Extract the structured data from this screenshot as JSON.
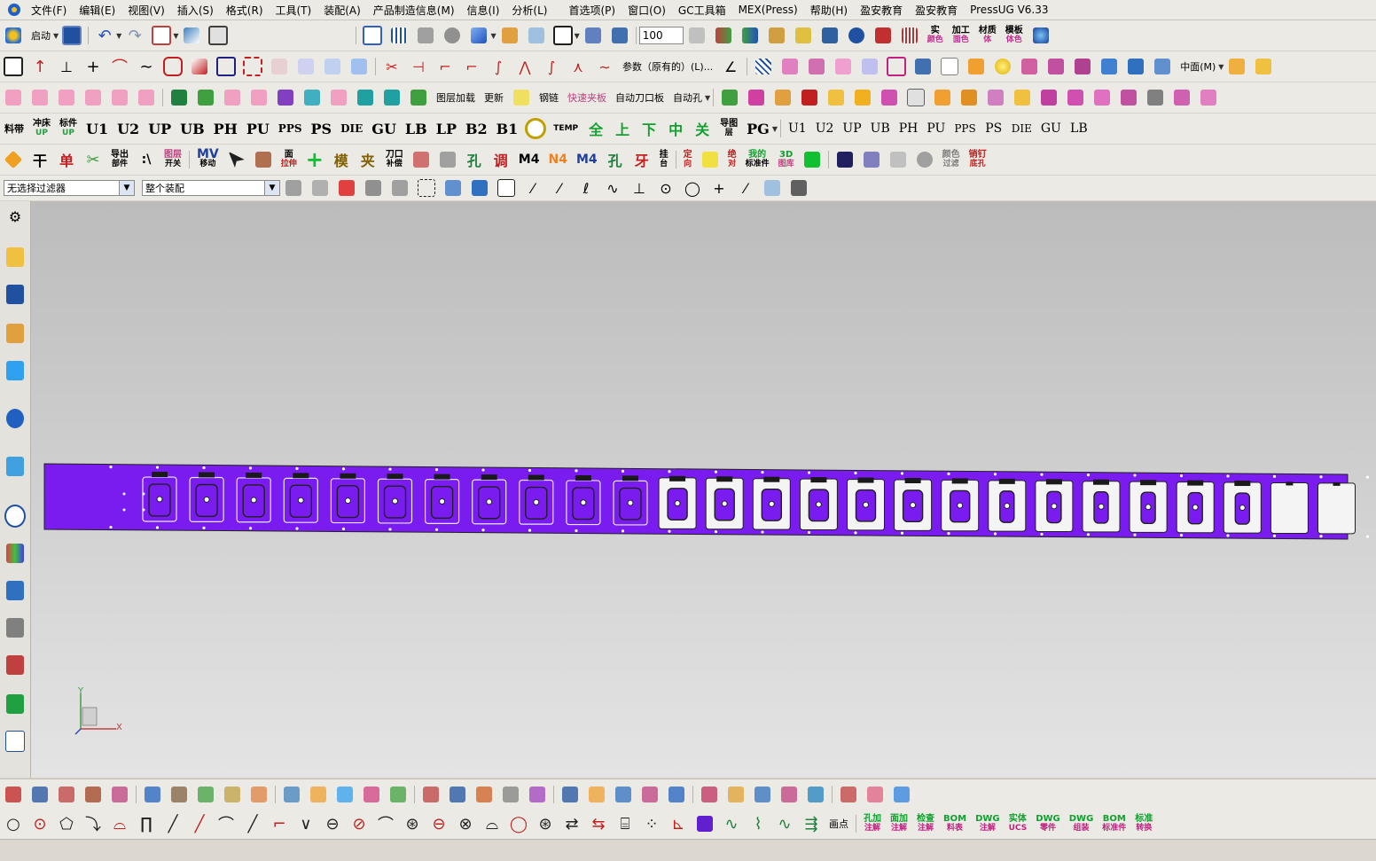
{
  "menu": [
    "文件(F)",
    "编辑(E)",
    "视图(V)",
    "插入(S)",
    "格式(R)",
    "工具(T)",
    "装配(A)",
    "产品制造信息(M)",
    "信息(I)",
    "分析(L)",
    "首选项(P)",
    "窗口(O)",
    "GC工具箱",
    "MEX(Press)",
    "帮助(H)",
    "盈安教育",
    "盈安教育",
    "PressUG V6.33"
  ],
  "toolbar1": {
    "start_label": "启动",
    "zoom_value": "100",
    "right_labels": [
      [
        "实",
        "颜色"
      ],
      [
        "加工",
        "面色"
      ],
      [
        "材质",
        "体"
      ],
      [
        "模板",
        "体色"
      ]
    ]
  },
  "toolbar2": {
    "params_label": "参数（原有的）(L)...",
    "face_label": "中面(M)"
  },
  "toolbar3": {
    "labels": [
      "自动刀口板",
      "自动孔"
    ],
    "small": [
      "图层加载",
      "更新",
      "钢链",
      "快速夹板"
    ]
  },
  "toolbar4": {
    "labels": [
      "U1",
      "U2",
      "UP",
      "UB",
      "PH",
      "PU",
      "PPS",
      "PS",
      "DIE",
      "GU",
      "LB",
      "LP",
      "B2",
      "B1"
    ],
    "chars": [
      "全",
      "上",
      "下",
      "中",
      "关"
    ],
    "right": [
      "U1",
      "U2",
      "UP",
      "UB",
      "PH",
      "PU",
      "PPS",
      "PS",
      "DIE",
      "GU",
      "LB"
    ],
    "pg_label": "PG",
    "temp_label": "TEMP"
  },
  "toolbar5": {
    "chars": [
      "干",
      "单",
      "模",
      "夹",
      "调",
      "孔",
      "牙"
    ],
    "labels": [
      "M4",
      "N4",
      "M4",
      "3D"
    ]
  },
  "filter": {
    "selection_filter": "无选择过滤器",
    "assembly_scope": "整个装配"
  },
  "bottom2_labels": [
    "画点"
  ],
  "bottom2_right": [
    [
      "孔加",
      "注解"
    ],
    [
      "面加",
      "注解"
    ],
    [
      "检查",
      "注解"
    ],
    [
      "BOM",
      "料表"
    ],
    [
      "DWG",
      "注解"
    ],
    [
      "实体",
      "UCS"
    ],
    [
      "DWG",
      "零件"
    ],
    [
      "DWG",
      "组装"
    ],
    [
      "BOM",
      "标准件"
    ],
    [
      "标准",
      "转换"
    ]
  ],
  "triad": {
    "x": "X",
    "y": "Y"
  },
  "strip": {
    "color": "#7a1cf0",
    "stations": 26
  },
  "colors": {
    "accent": "#7a1cf0",
    "window_bg": "#eceae4"
  }
}
